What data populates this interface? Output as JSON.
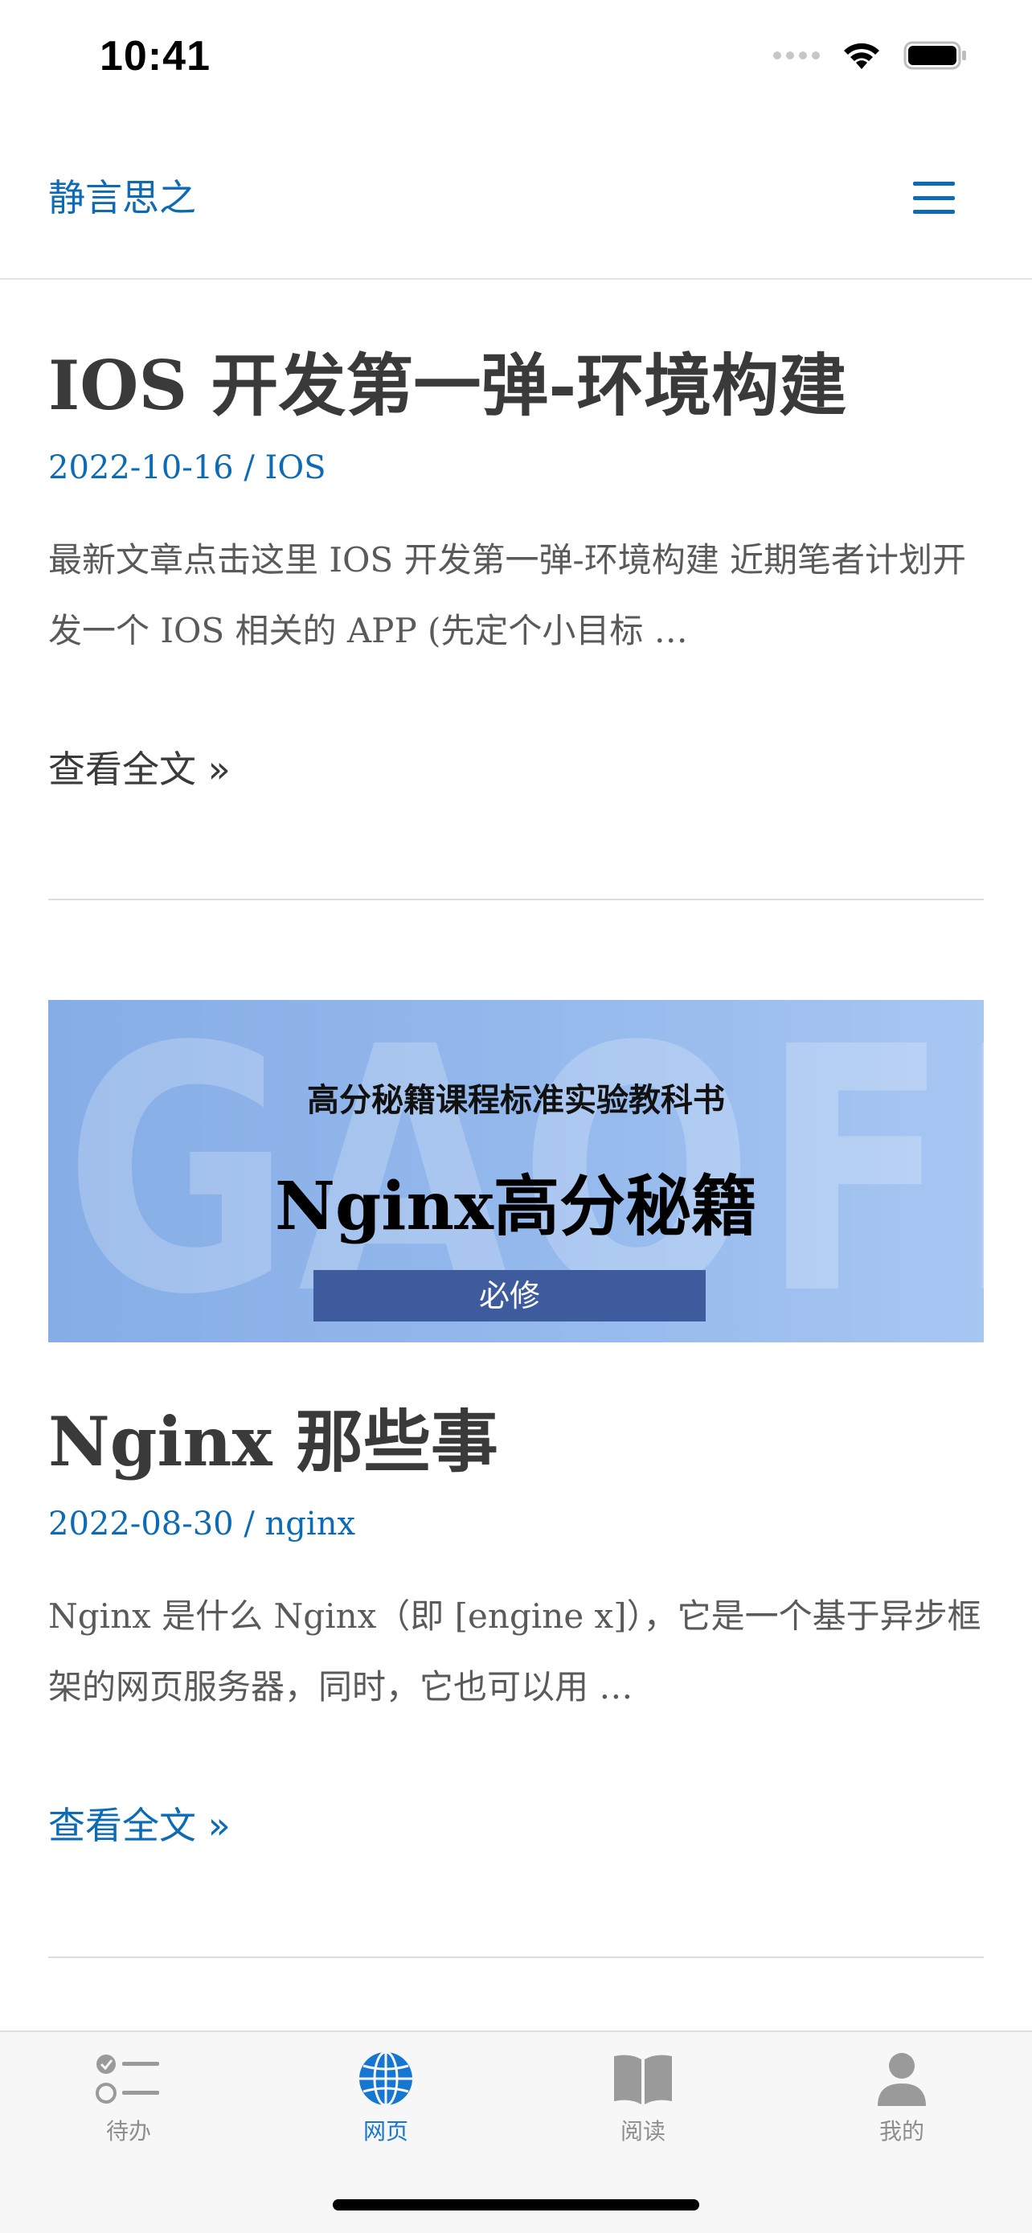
{
  "status_bar": {
    "time": "10:41"
  },
  "header": {
    "site_title": "静言思之"
  },
  "articles": [
    {
      "title": "IOS 开发第一弹-环境构建",
      "date": "2022-10-16",
      "separator": " / ",
      "category": "IOS",
      "excerpt": "最新文章点击这里 IOS 开发第一弹-环境构建 近期笔者计划开发一个 IOS 相关的 APP (先定个小目标 …",
      "read_more": "查看全文 »",
      "read_more_color": "#3a3a3a"
    },
    {
      "banner": {
        "watermark": "GAOFEN",
        "subtitle": "高分秘籍课程标准实验教科书",
        "title": "Nginx高分秘籍",
        "badge": "必修"
      },
      "title": "Nginx 那些事",
      "date": "2022-08-30",
      "separator": " / ",
      "category": "nginx",
      "excerpt": "Nginx 是什么 Nginx（即 [engine x]），它是一个基于异步框架的网页服务器，同时，它也可以用 …",
      "read_more": "查看全文 »",
      "read_more_color": "#0c6bb4"
    }
  ],
  "tab_bar": {
    "tabs": [
      {
        "label": "待办",
        "icon": "checklist-icon",
        "active": false
      },
      {
        "label": "网页",
        "icon": "globe-icon",
        "active": true
      },
      {
        "label": "阅读",
        "icon": "book-icon",
        "active": false
      },
      {
        "label": "我的",
        "icon": "person-icon",
        "active": false
      }
    ]
  },
  "colors": {
    "accent": "#0c6bb4",
    "tab_active": "#1677d2",
    "tab_inactive": "#8e8e8e"
  }
}
